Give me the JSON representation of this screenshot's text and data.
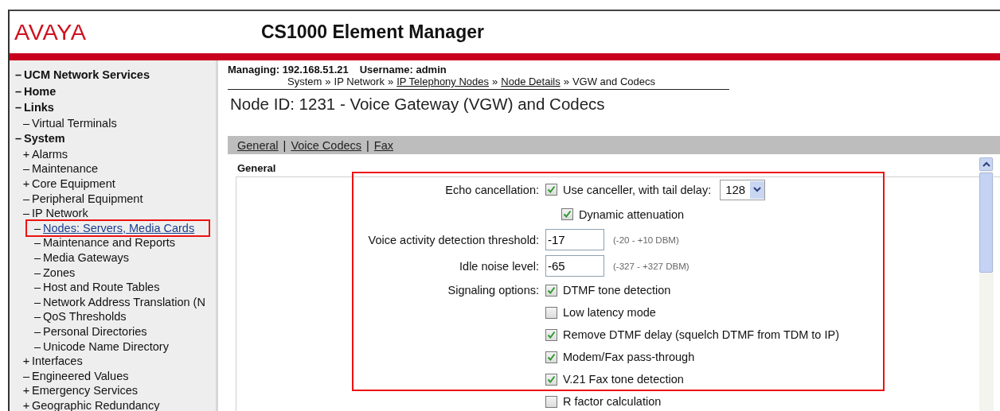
{
  "header": {
    "logo": "AVAYA",
    "title": "CS1000 Element Manager"
  },
  "sidebar": {
    "items": [
      {
        "marker": "–",
        "label": "UCM Network Services"
      },
      {
        "marker": "–",
        "label": "Home"
      },
      {
        "marker": "–",
        "label": "Links",
        "children": [
          {
            "marker": "–",
            "label": "Virtual Terminals"
          }
        ]
      },
      {
        "marker": "–",
        "label": "System",
        "children": [
          {
            "marker": "+",
            "label": "Alarms"
          },
          {
            "marker": "–",
            "label": "Maintenance"
          },
          {
            "marker": "+",
            "label": "Core Equipment"
          },
          {
            "marker": "–",
            "label": "Peripheral Equipment"
          },
          {
            "marker": "–",
            "label": "IP Network",
            "children": [
              {
                "marker": "–",
                "label": "Nodes: Servers, Media Cards",
                "selected": true,
                "highlighted": true
              },
              {
                "marker": "–",
                "label": "Maintenance and Reports",
                "selected": false,
                "highlighted": false
              },
              {
                "marker": "–",
                "label": "Media Gateways",
                "selected": false,
                "highlighted": false
              },
              {
                "marker": "–",
                "label": "Zones",
                "selected": false,
                "highlighted": false
              },
              {
                "marker": "–",
                "label": "Host and Route Tables",
                "selected": false,
                "highlighted": false
              },
              {
                "marker": "–",
                "label": "Network Address Translation (N",
                "selected": false,
                "highlighted": false
              },
              {
                "marker": "–",
                "label": "QoS Thresholds",
                "selected": false,
                "highlighted": false
              },
              {
                "marker": "–",
                "label": "Personal Directories",
                "selected": false,
                "highlighted": false
              },
              {
                "marker": "–",
                "label": "Unicode Name Directory",
                "selected": false,
                "highlighted": false
              }
            ]
          },
          {
            "marker": "+",
            "label": "Interfaces"
          },
          {
            "marker": "–",
            "label": "Engineered Values"
          },
          {
            "marker": "+",
            "label": "Emergency Services"
          },
          {
            "marker": "+",
            "label": "Geographic Redundancy"
          }
        ]
      }
    ]
  },
  "status": {
    "managing_label": "Managing:",
    "managing": "192.168.51.21",
    "username_label": "Username:",
    "username": "admin"
  },
  "breadcrumb_separator": "»",
  "tab_separator": "|",
  "breadcrumb": [
    {
      "text": "System",
      "link": false
    },
    {
      "text": "IP Network",
      "link": false
    },
    {
      "text": "IP Telephony Nodes",
      "link": true
    },
    {
      "text": "Node Details",
      "link": true
    },
    {
      "text": "VGW and Codecs",
      "link": false
    }
  ],
  "heading": "Node ID: 1231 - Voice Gateway (VGW) and Codecs",
  "tabs": [
    {
      "label": "General"
    },
    {
      "label": "Voice Codecs"
    },
    {
      "label": "Fax"
    }
  ],
  "section": "General",
  "form": {
    "highlighted": true,
    "rows": [
      {
        "kind": "checkbox",
        "label": "Echo cancellation:",
        "checked": true,
        "text": "Use canceller, with tail delay:",
        "select": "128"
      },
      {
        "kind": "checkbox",
        "checked": true,
        "text": "Dynamic attenuation",
        "indent": true
      },
      {
        "kind": "number",
        "label": "Voice activity detection threshold:",
        "value": "-17",
        "hint": "(-20 - +10 DBM)"
      },
      {
        "kind": "number",
        "label": "Idle noise level:",
        "value": "-65",
        "hint": "(-327 - +327 DBM)"
      },
      {
        "kind": "checkbox",
        "label": "Signaling options:",
        "checked": true,
        "text": "DTMF tone detection"
      },
      {
        "kind": "checkbox",
        "checked": false,
        "text": "Low latency mode"
      },
      {
        "kind": "checkbox",
        "checked": true,
        "text": "Remove DTMF delay (squelch DTMF from TDM to IP)"
      },
      {
        "kind": "checkbox",
        "checked": true,
        "text": "Modem/Fax pass-through"
      },
      {
        "kind": "checkbox",
        "checked": true,
        "text": "V.21 Fax tone detection"
      },
      {
        "kind": "checkbox",
        "checked": false,
        "text": "R factor calculation"
      }
    ]
  }
}
